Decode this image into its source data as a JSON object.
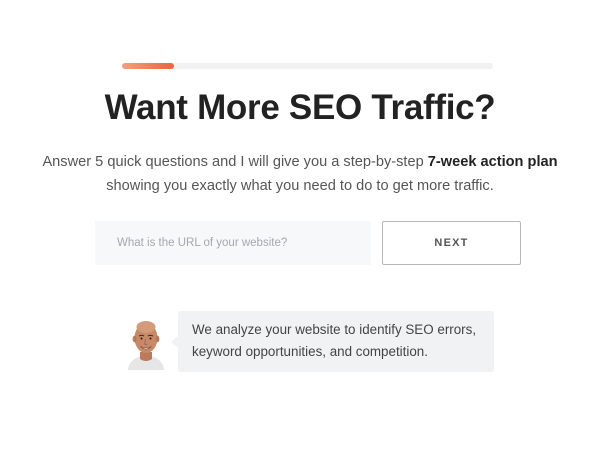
{
  "progress": {
    "fraction": 0.14,
    "fill_color": "#e8653e"
  },
  "heading": {
    "title": "Want More SEO Traffic?"
  },
  "intro": {
    "line_start": "Answer 5 quick questions and I will give you a step-by-step ",
    "emphasis": "7-week action plan",
    "line_end": "showing you exactly what you need to do to get more traffic."
  },
  "form": {
    "url_placeholder": "What is the URL of your website?",
    "url_value": "",
    "next_label": "NEXT"
  },
  "message": {
    "avatar_icon": "person-avatar-icon",
    "text_line1": "We analyze your website to identify SEO errors,",
    "text_line2": "keyword opportunities, and competition."
  }
}
